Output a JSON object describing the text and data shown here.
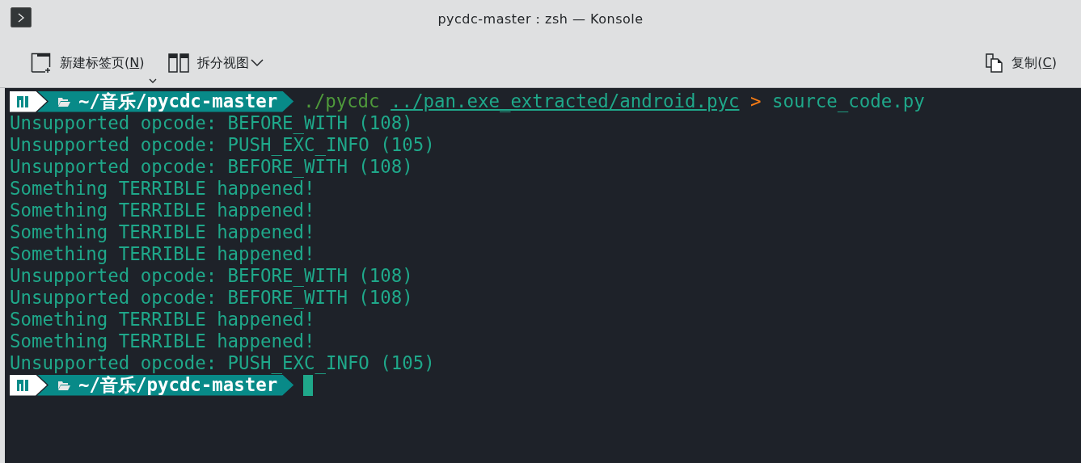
{
  "window": {
    "title": "pycdc-master : zsh — Konsole"
  },
  "toolbar": {
    "left": [
      {
        "kind": "new-tab",
        "label_before": "新建标签页(",
        "accel": "N",
        "label_after": ")",
        "has_menu": true
      },
      {
        "kind": "split-view",
        "label": "拆分视图",
        "has_menu": true
      }
    ],
    "right": [
      {
        "kind": "copy",
        "label_before": "复制(",
        "accel": "C",
        "label_after": ")"
      }
    ]
  },
  "terminal": {
    "lines": [
      {
        "kind": "prompt",
        "path": "~/音乐/pycdc-master",
        "command": [
          {
            "kind": "program",
            "text": "./pycdc"
          },
          {
            "kind": "path",
            "text": "../pan.exe_extracted/android.pyc"
          },
          {
            "kind": "operator",
            "text": ">"
          },
          {
            "kind": "argument",
            "text": "source_code.py"
          }
        ],
        "cursor": false
      },
      {
        "kind": "output",
        "text": "Unsupported opcode: BEFORE_WITH (108)"
      },
      {
        "kind": "output",
        "text": "Unsupported opcode: PUSH_EXC_INFO (105)"
      },
      {
        "kind": "output",
        "text": "Unsupported opcode: BEFORE_WITH (108)"
      },
      {
        "kind": "output",
        "text": "Something TERRIBLE happened!"
      },
      {
        "kind": "output",
        "text": "Something TERRIBLE happened!"
      },
      {
        "kind": "output",
        "text": "Something TERRIBLE happened!"
      },
      {
        "kind": "output",
        "text": "Something TERRIBLE happened!"
      },
      {
        "kind": "output",
        "text": "Unsupported opcode: BEFORE_WITH (108)"
      },
      {
        "kind": "output",
        "text": "Unsupported opcode: BEFORE_WITH (108)"
      },
      {
        "kind": "output",
        "text": "Something TERRIBLE happened!"
      },
      {
        "kind": "output",
        "text": "Something TERRIBLE happened!"
      },
      {
        "kind": "output",
        "text": "Unsupported opcode: PUSH_EXC_INFO (105)"
      },
      {
        "kind": "prompt",
        "path": "~/音乐/pycdc-master",
        "cursor": true
      }
    ]
  }
}
